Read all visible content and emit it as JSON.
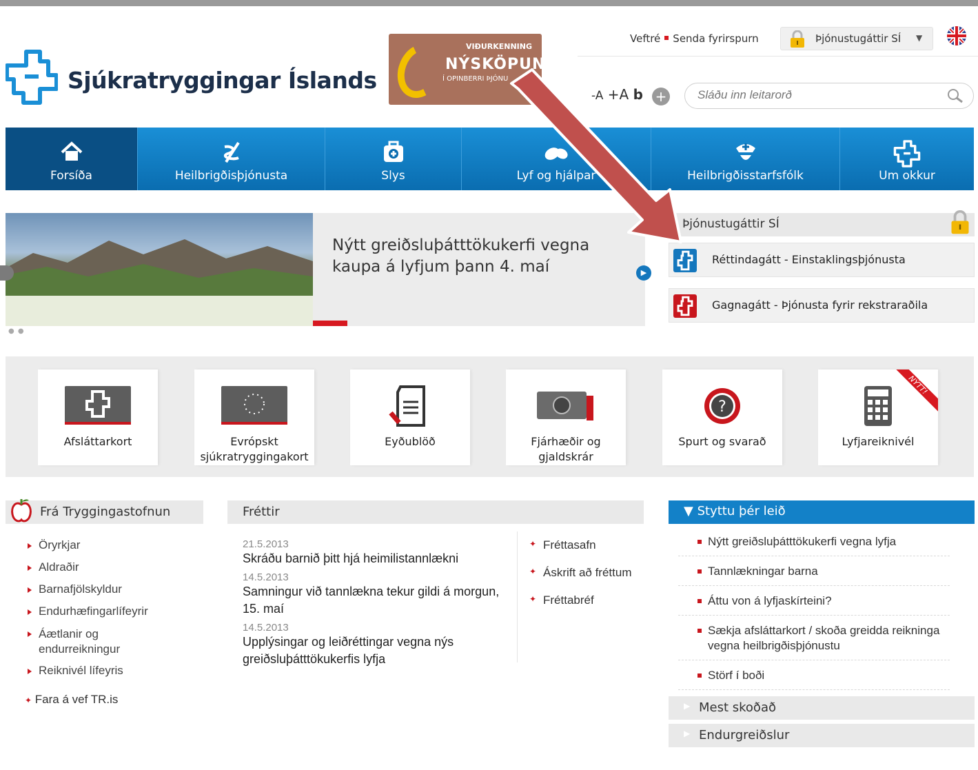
{
  "header": {
    "logo_text": "Sjúkratryggingar Íslands",
    "award": {
      "line1": "VIÐURKENNING",
      "line2": "NÝSKÖPUN",
      "line3": "Í OPINBERRI ÞJÓNU"
    },
    "top_links": [
      "Veftré",
      "Senda fyrirspurn"
    ],
    "portal_dropdown": "Þjónustugáttir SÍ",
    "font_controls": {
      "smaller": "-A",
      "larger": "+A",
      "bold": "b"
    },
    "search_placeholder": "Sláðu inn leitarorð"
  },
  "nav": [
    {
      "label": "Forsíða",
      "icon": "home-icon",
      "active": true
    },
    {
      "label": "Heilbrigðisþjónusta",
      "icon": "health-icon"
    },
    {
      "label": "Slys",
      "icon": "firstaid-icon"
    },
    {
      "label": "Lyf og hjálpar",
      "icon": "pills-icon"
    },
    {
      "label": "Heilbrigðisstarfsfólk",
      "icon": "nurse-icon"
    },
    {
      "label": "Um okkur",
      "icon": "logo-icon"
    }
  ],
  "slider": {
    "title": "Nýtt greiðsluþátttökukerfi vegna kaupa á lyfjum þann 4. maí"
  },
  "portal_box": {
    "title": "Þjónustugáttir SÍ",
    "items": [
      {
        "label": "Réttindagátt - Einstaklingsþjónusta",
        "color": "#1477bd"
      },
      {
        "label": "Gagnagátt - Þjónusta fyrir rekstraraðila",
        "color": "#c8161d"
      }
    ]
  },
  "quick_links": [
    {
      "label": "Afsláttarkort",
      "icon": "discount-card-icon"
    },
    {
      "label": "Evrópskt sjúkratryggingakort",
      "icon": "eu-card-icon"
    },
    {
      "label": "Eyðublöð",
      "icon": "forms-icon"
    },
    {
      "label": "Fjárhæðir og gjaldskrár",
      "icon": "money-icon"
    },
    {
      "label": "Spurt og svarað",
      "icon": "question-icon"
    },
    {
      "label": "Lyfjareiknivél",
      "icon": "calculator-icon",
      "badge": "NÝTT!"
    }
  ],
  "tr": {
    "title": "Frá Tryggingastofnun",
    "items": [
      "Öryrkjar",
      "Aldraðir",
      "Barnafjölskyldur",
      "Endurhæfingarlífeyrir",
      "Áætlanir og endurreikningur",
      "Reiknivél lífeyris"
    ],
    "footer_link": "Fara á vef TR.is"
  },
  "news": {
    "title": "Fréttir",
    "items": [
      {
        "date": "21.5.2013",
        "headline": "Skráðu barnið þitt hjá heimilistannlækni"
      },
      {
        "date": "14.5.2013",
        "headline": "Samningur við tannlækna tekur gildi á morgun, 15. maí"
      },
      {
        "date": "14.5.2013",
        "headline": "Upplýsingar og leiðréttingar vegna nýs greiðsluþátttökukerfis lyfja"
      }
    ],
    "links": [
      "Fréttasafn",
      "Áskrift að fréttum",
      "Fréttabréf"
    ]
  },
  "shortcuts": {
    "title": "Styttu þér leið",
    "items": [
      "Nýtt greiðsluþátttökukerfi vegna lyfja",
      "Tannlækningar barna",
      "Áttu von á lyfjaskírteini?",
      "Sækja afsláttarkort / skoða greidda reikninga vegna heilbrigðisþjónustu",
      "Störf í boði"
    ],
    "accordions": [
      "Mest skoðað",
      "Endurgreiðslur"
    ]
  }
}
